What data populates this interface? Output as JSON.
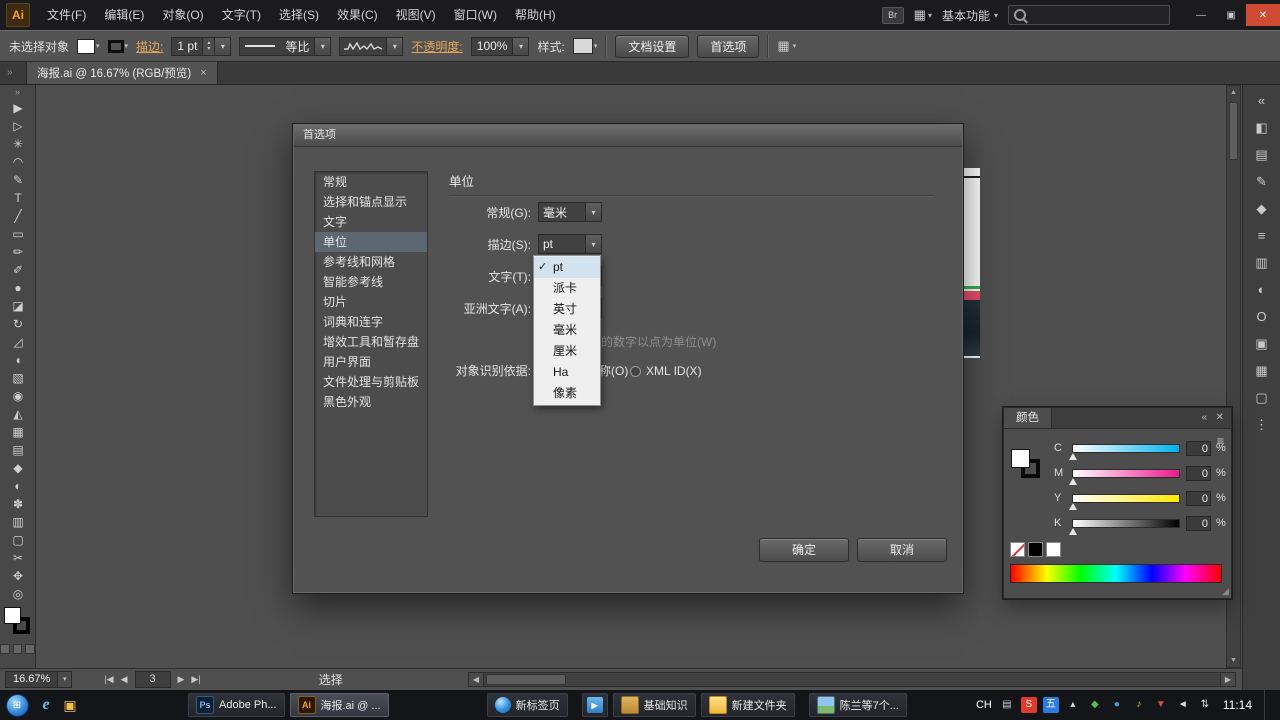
{
  "ui": {
    "caret_down": "▾",
    "caret_up": "▴",
    "arrow_up": "▲",
    "arrow_down": "▼",
    "arrow_left": "◀",
    "arrow_right": "▶",
    "first_arrow": "|◀",
    "last_arrow": "▶|",
    "chevrons_right": "»",
    "chevrons_left": "«",
    "close_glyph": "✕",
    "minimize_glyph": "—",
    "restore_glyph": "▣",
    "menu_glyph": "≡",
    "check": "✓",
    "grip_glyph": "◢",
    "start_glyph": "⊞"
  },
  "colors": {
    "accent_orange": "#f5a024",
    "selection_highlight": "#5d6772",
    "cyan": "#00b3ee",
    "magenta": "#ec1a8d",
    "yellow": "#ffe800",
    "close_red": "#cf4b33"
  },
  "menubar": {
    "logo": "Ai",
    "items": [
      "文件(F)",
      "编辑(E)",
      "对象(O)",
      "文字(T)",
      "选择(S)",
      "效果(C)",
      "视图(V)",
      "窗口(W)",
      "帮助(H)"
    ],
    "bridge": "Br",
    "arrange_icon": "▦",
    "workspace": "基本功能",
    "search_value": ""
  },
  "controlbar": {
    "status": "未选择对象",
    "stroke_link": "描边:",
    "stroke_value": "1 pt",
    "brush_value": "等比",
    "opacity_link": "不透明度:",
    "opacity_value": "100%",
    "style_label": "样式:",
    "doc_setup_button": "文档设置",
    "preferences_button": "首选项"
  },
  "tab": {
    "title": "海报.ai @ 16.67% (RGB/预览)",
    "close": "×"
  },
  "tools": [
    {
      "name": "selection-tool-icon",
      "glyph": "▶"
    },
    {
      "name": "direct-selection-tool-icon",
      "glyph": "▷"
    },
    {
      "name": "magic-wand-tool-icon",
      "glyph": "✳"
    },
    {
      "name": "lasso-tool-icon",
      "glyph": "◠"
    },
    {
      "name": "pen-tool-icon",
      "glyph": "✎"
    },
    {
      "name": "type-tool-icon",
      "glyph": "T"
    },
    {
      "name": "line-segment-tool-icon",
      "glyph": "╱"
    },
    {
      "name": "rectangle-tool-icon",
      "glyph": "▭"
    },
    {
      "name": "paintbrush-tool-icon",
      "glyph": "✏"
    },
    {
      "name": "pencil-tool-icon",
      "glyph": "✐"
    },
    {
      "name": "blob-brush-tool-icon",
      "glyph": "●"
    },
    {
      "name": "eraser-tool-icon",
      "glyph": "◪"
    },
    {
      "name": "rotate-tool-icon",
      "glyph": "↻"
    },
    {
      "name": "scale-tool-icon",
      "glyph": "◿"
    },
    {
      "name": "width-tool-icon",
      "glyph": "◖"
    },
    {
      "name": "free-transform-tool-icon",
      "glyph": "▧"
    },
    {
      "name": "shape-builder-tool-icon",
      "glyph": "◉"
    },
    {
      "name": "perspective-grid-tool-icon",
      "glyph": "◭"
    },
    {
      "name": "mesh-tool-icon",
      "glyph": "▦"
    },
    {
      "name": "gradient-tool-icon",
      "glyph": "▤"
    },
    {
      "name": "eyedropper-tool-icon",
      "glyph": "◆"
    },
    {
      "name": "blend-tool-icon",
      "glyph": "◐"
    },
    {
      "name": "symbol-sprayer-tool-icon",
      "glyph": "✽"
    },
    {
      "name": "column-graph-tool-icon",
      "glyph": "▥"
    },
    {
      "name": "artboard-tool-icon",
      "glyph": "▢"
    },
    {
      "name": "slice-tool-icon",
      "glyph": "✂"
    },
    {
      "name": "hand-tool-icon",
      "glyph": "✥"
    },
    {
      "name": "zoom-tool-icon",
      "glyph": "◎"
    }
  ],
  "dock": [
    {
      "name": "expand-panels-icon",
      "glyph": "«"
    },
    {
      "name": "color-panel-icon",
      "glyph": "◧"
    },
    {
      "name": "swatches-panel-icon",
      "glyph": "▤"
    },
    {
      "name": "brushes-panel-icon",
      "glyph": "✎"
    },
    {
      "name": "symbols-panel-icon",
      "glyph": "◆"
    },
    {
      "name": "stroke-panel-icon",
      "glyph": "≡"
    },
    {
      "name": "gradient-panel-icon",
      "glyph": "▥"
    },
    {
      "name": "transparency-panel-icon",
      "glyph": "◐"
    },
    {
      "name": "appearance-panel-icon",
      "glyph": "O"
    },
    {
      "name": "graphic-styles-panel-icon",
      "glyph": "▣"
    },
    {
      "name": "layers-panel-icon",
      "glyph": "▦"
    },
    {
      "name": "artboards-panel-icon",
      "glyph": "▢"
    },
    {
      "name": "align-panel-icon",
      "glyph": "⋮"
    }
  ],
  "dialog": {
    "title": "首选项",
    "section": "单位",
    "categories": [
      "常规",
      "选择和锚点显示",
      "文字",
      "单位",
      "参考线和网格",
      "智能参考线",
      "切片",
      "词典和连字",
      "增效工具和暂存盘",
      "用户界面",
      "文件处理与剪贴板",
      "黑色外观"
    ],
    "fields": {
      "general_label": "常规(G):",
      "general_value": "毫米",
      "stroke_label": "描边(S):",
      "stroke_value": "pt",
      "type_label": "文字(T):",
      "asian_label": "亚洲文字(A):"
    },
    "unit_menu": {
      "selected": "pt",
      "options": [
        "pt",
        "派卡",
        "英寸",
        "毫米",
        "厘米",
        "Ha",
        "像素"
      ]
    },
    "disabled_hint": "的数字以点为单位(W)",
    "identify_label": "对象识别依据:",
    "identify_option1_fragment": "称(O)",
    "identify_option2": "XML ID(X)",
    "ok": "确定",
    "cancel": "取消"
  },
  "color_panel": {
    "title": "颜色",
    "channels": [
      {
        "label": "C",
        "value": "0",
        "unit": "%"
      },
      {
        "label": "M",
        "value": "0",
        "unit": "%"
      },
      {
        "label": "Y",
        "value": "0",
        "unit": "%"
      },
      {
        "label": "K",
        "value": "0",
        "unit": "%"
      }
    ]
  },
  "statusbar": {
    "zoom": "16.67%",
    "artboard": "3",
    "tool_status": "选择"
  },
  "taskbar": {
    "apps": [
      {
        "name": "taskbar-photoshop",
        "icon_text": "Ps",
        "label": "Adobe Ph..."
      },
      {
        "name": "taskbar-illustrator",
        "icon_text": "Ai",
        "label": "海报.ai @ ..."
      },
      {
        "name": "taskbar-browser-newtab",
        "icon_text": "",
        "label": "新标签页"
      },
      {
        "name": "taskbar-player",
        "icon_text": "▶",
        "label": ""
      },
      {
        "name": "taskbar-notes",
        "icon_text": "",
        "label": "基础知识"
      },
      {
        "name": "taskbar-folder",
        "icon_text": "",
        "label": "新建文件夹"
      },
      {
        "name": "taskbar-photos",
        "icon_text": "",
        "label": "陈兰等7个..."
      }
    ],
    "quick_ie": "e",
    "quick_explorer": "▣",
    "lang": "CH",
    "tray": [
      {
        "name": "keyboard-icon",
        "glyph": "▤",
        "color": "#c8cdd6"
      },
      {
        "name": "sogou-input-icon",
        "glyph": "S",
        "color": "#ffffff",
        "bg": "#e03a2a"
      },
      {
        "name": "ime-mode-icon",
        "glyph": "五",
        "color": "#ffffff",
        "bg": "#2d7ae0"
      },
      {
        "name": "hidden-icons-icon",
        "glyph": "▴",
        "color": "#d6dae2"
      },
      {
        "name": "security-icon",
        "glyph": "◆",
        "color": "#58c052"
      },
      {
        "name": "messenger-icon",
        "glyph": "●",
        "color": "#3aa0e8"
      },
      {
        "name": "music-icon",
        "glyph": "♪",
        "color": "#e8c04a"
      },
      {
        "name": "download-icon",
        "glyph": "▼",
        "color": "#d05043"
      },
      {
        "name": "volume-icon",
        "glyph": "◄",
        "color": "#d6dae2"
      },
      {
        "name": "network-icon",
        "glyph": "⇅",
        "color": "#d6dae2"
      }
    ],
    "time": "11:14"
  }
}
